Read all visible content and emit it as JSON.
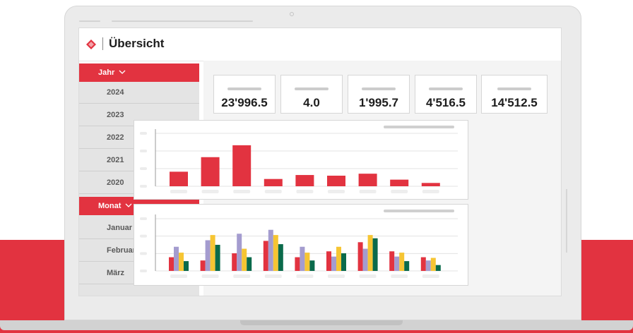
{
  "app": {
    "title": "Übersicht"
  },
  "sidebar": {
    "jahr": {
      "label": "Jahr",
      "items": [
        "2024",
        "2023",
        "2022",
        "2021",
        "2020"
      ]
    },
    "monat": {
      "label": "Monat",
      "items": [
        "Januar",
        "Februar",
        "März"
      ]
    }
  },
  "kpis": [
    "23'996.5",
    "4.0",
    "1'995.7",
    "4'516.5",
    "14'512.5"
  ],
  "colors": {
    "accent": "#e23340",
    "lavender": "#a49ccf",
    "yellow": "#f6c533",
    "green": "#0a6a4b"
  },
  "chart_data": [
    {
      "type": "bar",
      "title": "",
      "values": [
        22,
        44,
        62,
        11,
        17,
        16,
        19,
        10,
        5
      ],
      "ylim": [
        0,
        80
      ],
      "grid": true
    },
    {
      "type": "bar",
      "title": "",
      "series": [
        {
          "color": "#e23340",
          "values": [
            21,
            16,
            27,
            46,
            21,
            30,
            44,
            30,
            21
          ]
        },
        {
          "color": "#a49ccf",
          "values": [
            37,
            47,
            57,
            63,
            37,
            22,
            34,
            22,
            16
          ]
        },
        {
          "color": "#f6c533",
          "values": [
            28,
            55,
            34,
            55,
            28,
            37,
            55,
            28,
            20
          ]
        },
        {
          "color": "#0a6a4b",
          "values": [
            15,
            40,
            21,
            41,
            16,
            27,
            50,
            15,
            9
          ]
        }
      ],
      "ylim": [
        0,
        80
      ],
      "grid": true
    }
  ]
}
